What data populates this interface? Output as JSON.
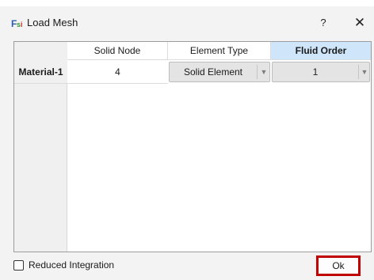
{
  "window": {
    "title": "Load Mesh",
    "help_label": "?",
    "close_label": "✕",
    "icon_name": "fsi-app-icon"
  },
  "table": {
    "columns": [
      "Solid Node",
      "Element Type",
      "Fluid Order"
    ],
    "active_column": "Fluid Order",
    "rows": [
      {
        "label": "Material-1",
        "solid_node": "4",
        "element_type": "Solid Element",
        "fluid_order": "1"
      }
    ]
  },
  "footer": {
    "reduced_integration_label": "Reduced Integration",
    "reduced_integration_checked": false,
    "ok_label": "Ok"
  },
  "colors": {
    "active_header": "#cfe6fa",
    "ok_highlight": "#c00000"
  }
}
